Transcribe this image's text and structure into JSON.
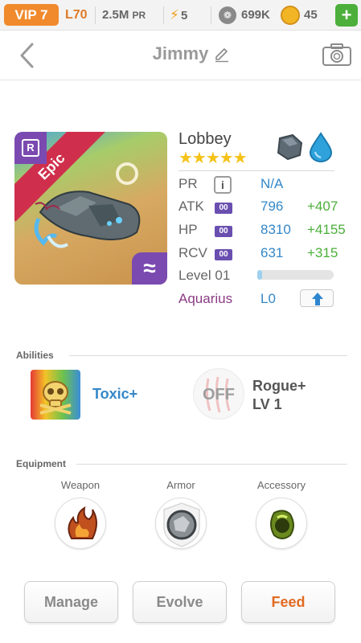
{
  "topbar": {
    "vip": "VIP 7",
    "level": "L70",
    "pr_value": "2.5M",
    "pr_unit": "PR",
    "energy": "5",
    "paw_currency": "699K",
    "coins": "45",
    "add_label": "+"
  },
  "header": {
    "title": "Jimmy"
  },
  "pet": {
    "name": "Lobbey",
    "rarity": "Epic",
    "rarity_letter": "R",
    "stars": "★★★★★",
    "element_corner": "≈",
    "elements": [
      "rock-element-icon",
      "water-element-icon"
    ],
    "stats": {
      "pr": {
        "label": "PR",
        "value": "N/A"
      },
      "atk": {
        "label": "ATK",
        "badge": "00",
        "value": "796",
        "bonus": "+407"
      },
      "hp": {
        "label": "HP",
        "badge": "00",
        "value": "8310",
        "bonus": "+4155"
      },
      "rcv": {
        "label": "RCV",
        "badge": "00",
        "value": "631",
        "bonus": "+315"
      }
    },
    "level_label": "Level 01",
    "level_progress": 0.06,
    "constellation": {
      "label": "Aquarius",
      "value": "L0"
    }
  },
  "abilities": {
    "title": "Abilities",
    "ability1": {
      "name": "Toxic+"
    },
    "ability2": {
      "state": "OFF",
      "name": "Rogue+",
      "level": "LV 1"
    }
  },
  "equipment": {
    "title": "Equipment",
    "weapon": "Weapon",
    "armor": "Armor",
    "accessory": "Accessory"
  },
  "actions": {
    "manage": "Manage",
    "evolve": "Evolve",
    "feed": "Feed"
  },
  "colors": {
    "accent_orange": "#f08a2c",
    "stat_blue": "#3487c8",
    "bonus_green": "#4caf3b",
    "epic_red": "#cf2f4c",
    "rarity_purple": "#7a4ab0",
    "aquarius_purple": "#8b3b84"
  }
}
